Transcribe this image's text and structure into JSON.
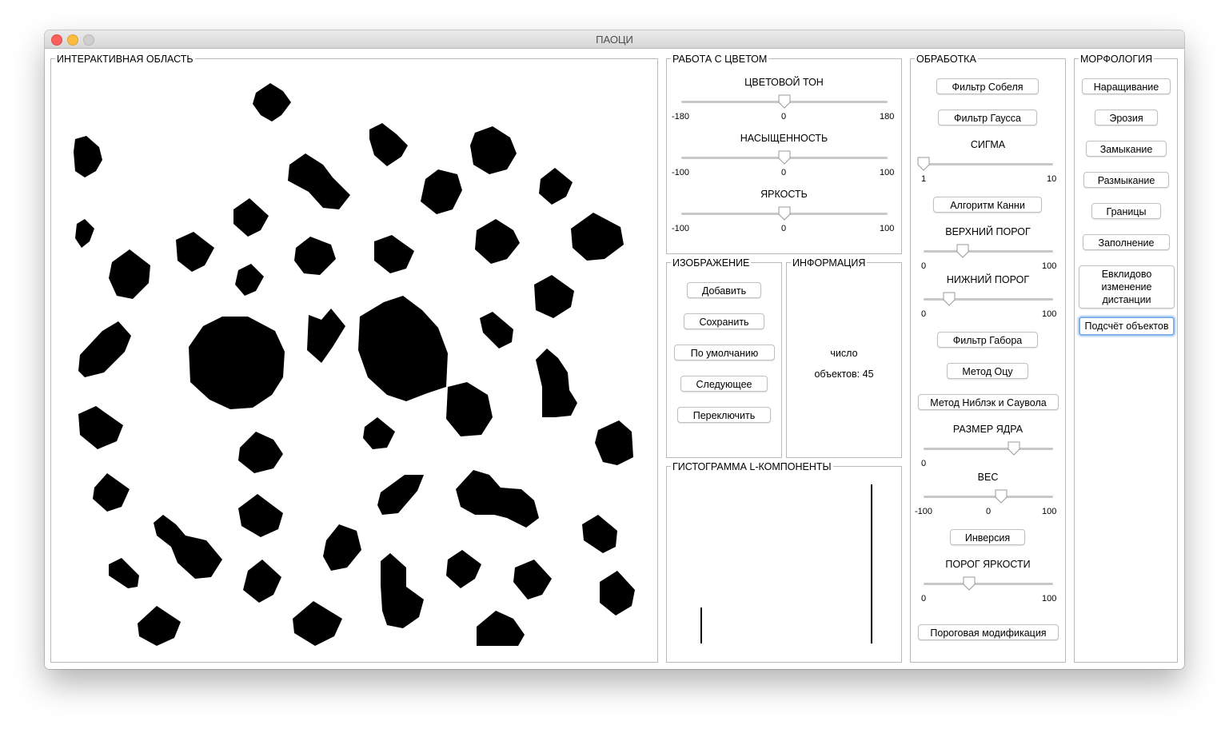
{
  "window": {
    "title": "ПАОЦИ"
  },
  "panels": {
    "interactive": "ИНТЕРАКТИВНАЯ ОБЛАСТЬ",
    "color": "РАБОТА С ЦВЕТОМ",
    "image": "ИЗОБРАЖЕНИЕ",
    "info": "ИНФОРМАЦИЯ",
    "histogram": "ГИСТОГРАММА L-КОМПОНЕНТЫ",
    "processing": "ОБРАБОТКА",
    "morphology": "МОРФОЛОГИЯ"
  },
  "color": {
    "hue": {
      "label": "ЦВЕТОВОЙ ТОН",
      "min": "-180",
      "mid": "0",
      "max": "180",
      "value_fraction": 0.5
    },
    "saturation": {
      "label": "НАСЫЩЕННОСТЬ",
      "min": "-100",
      "mid": "0",
      "max": "100",
      "value_fraction": 0.5
    },
    "brightness": {
      "label": "ЯРКОСТЬ",
      "min": "-100",
      "mid": "0",
      "max": "100",
      "value_fraction": 0.5
    }
  },
  "image": {
    "add": "Добавить",
    "save": "Сохранить",
    "default": "По умолчанию",
    "next": "Следующее",
    "switch": "Переключить"
  },
  "info": {
    "line1": "число",
    "line2": "объектов: 45"
  },
  "processing": {
    "sobel": "Фильтр Собеля",
    "gauss": "Фильтр Гаусса",
    "sigma": {
      "label": "СИГМА",
      "min": "1",
      "max": "10",
      "value_fraction": 0.0
    },
    "canny": "Алгоритм Канни",
    "upper": {
      "label": "ВЕРХНИЙ ПОРОГ",
      "min": "0",
      "max": "100",
      "value_fraction": 0.3
    },
    "lower": {
      "label": "НИЖНИЙ ПОРОГ",
      "min": "0",
      "max": "100",
      "value_fraction": 0.2
    },
    "gabor": "Фильтр Габора",
    "otsu": "Метод Оцу",
    "niblack": "Метод Ниблэк и Саувола",
    "kernel": {
      "label": "РАЗМЕР ЯДРА",
      "min": "0",
      "value_fraction": 0.7
    },
    "weight": {
      "label": "ВЕС",
      "min": "-100",
      "mid": "0",
      "max": "100",
      "value_fraction": 0.6
    },
    "inversion": "Инверсия",
    "brightness_threshold": {
      "label": "ПОРОГ ЯРКОСТИ",
      "min": "0",
      "max": "100",
      "value_fraction": 0.35
    },
    "threshold_mod": "Пороговая модификация"
  },
  "morphology": {
    "dilation": "Наращивание",
    "erosion": "Эрозия",
    "closing": "Замыкание",
    "opening": "Размыкание",
    "borders": "Границы",
    "fill": "Заполнение",
    "euclid": "Евклидово изменение дистанции",
    "count": "Подсчёт объектов"
  },
  "colors": {
    "slider_track": "#c8c8c8",
    "focus_ring": "#7fb2ea"
  }
}
